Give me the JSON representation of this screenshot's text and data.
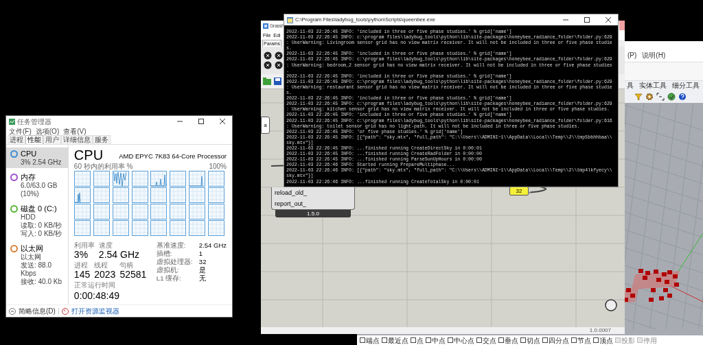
{
  "rhino": {
    "menus": [
      "(P)",
      "说明(H)"
    ],
    "ribbon_tabs": [
      "具",
      "实体工具",
      "细分工具"
    ],
    "osnaps": [
      {
        "label": "端点",
        "checked": false,
        "disabled": false
      },
      {
        "label": "最近点",
        "checked": false,
        "disabled": false
      },
      {
        "label": "点",
        "checked": false,
        "disabled": false
      },
      {
        "label": "中点",
        "checked": false,
        "disabled": false
      },
      {
        "label": "中心点",
        "checked": false,
        "disabled": false
      },
      {
        "label": "交点",
        "checked": false,
        "disabled": false
      },
      {
        "label": "垂点",
        "checked": false,
        "disabled": false
      },
      {
        "label": "切点",
        "checked": false,
        "disabled": false
      },
      {
        "label": "四分点",
        "checked": false,
        "disabled": false
      },
      {
        "label": "节点",
        "checked": false,
        "disabled": false
      },
      {
        "label": "顶点",
        "checked": false,
        "disabled": false
      },
      {
        "label": "投影",
        "checked": false,
        "disabled": true
      },
      {
        "label": "停用",
        "checked": false,
        "disabled": true
      }
    ]
  },
  "grasshopper": {
    "title": "Grassh",
    "menus": [
      "File",
      "Edi"
    ],
    "tab": "Params",
    "node_label": "a",
    "inputs": [
      "reload_old_",
      "report_out_"
    ],
    "version": "1.5.0",
    "panel_value": "32",
    "status": "1.0.0007"
  },
  "console": {
    "title": "C:\\Program Files\\ladybug_tools\\python\\Scripts\\queenbee.exe",
    "lines": [
      "2022-11-03 22:26:45 INFO: 'included in three or five phase studies.' % grid['name']",
      "2022-11-03 22:26:45 INFO: c:\\program files\\ladybug_tools\\python\\lib\\site-packages\\honeybee_radiance_folder\\folder.py:629",
      ": UserWarning: Livingroom sensor grid has no view matrix receiver. It will not be included in three or five phase studie",
      "s.",
      "2022-11-03 22:26:45 INFO: 'included in three or five phase studies.' % grid['name']",
      "2022-11-03 22:26:45 INFO: c:\\program files\\ladybug_tools\\python\\lib\\site-packages\\honeybee_radiance_folder\\folder.py:629",
      ": UserWarning: bedroom_2 sensor grid has no view matrix receiver. It will not be included in three or five phase studies",
      ".",
      "2022-11-03 22:26:45 INFO: 'included in three or five phase studies.' % grid['name']",
      "2022-11-03 22:26:45 INFO: c:\\program files\\ladybug_tools\\python\\lib\\site-packages\\honeybee_radiance_folder\\folder.py:629",
      ": UserWarning: restaurant sensor grid has no view matrix receiver. It will not be included in three or five phase studie",
      "s.",
      "2022-11-03 22:26:45 INFO: 'included in three or five phase studies.' % grid['name']",
      "2022-11-03 22:26:45 INFO: c:\\program files\\ladybug_tools\\python\\lib\\site-packages\\honeybee_radiance_folder\\folder.py:629",
      ": UserWarning: kitchen sensor grid has no view matrix receiver. It will not be included in three or five phase studies.",
      "2022-11-03 22:26:45 INFO: 'included in three or five phase studies.' % grid['name']",
      "2022-11-03 22:26:45 INFO: c:\\program files\\ladybug_tools\\python\\lib\\site-packages\\honeybee_radiance_folder\\folder.py:616",
      ": UserWarning: toilet sensor grid has no light-path. It will not be included in three or five phase studies.",
      "2022-11-03 22:26:45 INFO: 'or five phase studies.' % grid['name']",
      "2022-11-03 22:26:45 INFO: [{\"path\": \"sky.mtx\", \"full_path\": \"C:\\\\Users\\\\ADMINI~1\\\\AppData\\\\Local\\\\Temp\\\\2\\\\tmp5bbhhbaa\\\\",
      "sky.mtx\"}]",
      "2022-11-03 22:26:45 INFO: ...finished running CreateDirectSky in 0:00:01",
      "2022-11-03 22:26:45 INFO: ...finished running CreateRadFolder in 0:00:00",
      "2022-11-03 22:26:45 INFO: ...finished running ParseSunUpHours in 0:00:00",
      "2022-11-03 22:26:46 INFO: Started running PrepareMultiphase...",
      "2022-11-03 22:26:46 INFO: [{\"path\": \"sky.mtx\", \"full_path\": \"C:\\\\Users\\\\ADMINI~1\\\\AppData\\\\Local\\\\Temp\\\\2\\\\tmp4lkfyecy\\\\",
      "sky.mtx\"}]",
      "2022-11-03 22:26:46 INFO: ...finished running CreateTotalSky in 0:00:01"
    ]
  },
  "task_manager": {
    "title": "任务管理器",
    "menus": [
      "文件(F)",
      "选项(O)",
      "查看(V)"
    ],
    "tabs": [
      {
        "label": "进程",
        "selected": false
      },
      {
        "label": "性能",
        "selected": true
      },
      {
        "label": "用户",
        "selected": false
      },
      {
        "label": "详细信息",
        "selected": false
      },
      {
        "label": "服务",
        "selected": false
      }
    ],
    "resources": [
      {
        "name": "CPU",
        "lines": [
          "3% 2.54 GHz"
        ],
        "selected": true,
        "color": "#3b8ed8"
      },
      {
        "name": "内存",
        "lines": [
          "6.0/63.0 GB (10%)"
        ],
        "selected": false,
        "color": "#a04fcf"
      },
      {
        "name": "磁盘 0 (C:)",
        "lines": [
          "HDD",
          "读取: 0 KB/秒",
          "写入: 0 KB/秒"
        ],
        "selected": false,
        "color": "#5bb53a"
      },
      {
        "name": "以太网",
        "lines": [
          "以太网",
          "发送: 88.0 Kbps",
          "接收: 40.0 Kb"
        ],
        "selected": false,
        "color": "#d8843c"
      }
    ],
    "heading": "CPU",
    "processor": "AMD EPYC 7K83 64-Core Processor",
    "graph_label": "60 秒内的利用率 %",
    "graph_max": "100%",
    "stat_rows": [
      [
        {
          "label": "利用率",
          "value": "3%"
        },
        {
          "label": "速度",
          "value": "2.54 GHz"
        }
      ],
      [
        {
          "label": "进程",
          "value": "145"
        },
        {
          "label": "线程",
          "value": "2023"
        },
        {
          "label": "句柄",
          "value": "52581"
        }
      ]
    ],
    "uptime_label": "正常运行时间",
    "uptime": "0:00:48:49",
    "details": [
      {
        "label": "基准速度:",
        "value": "2.54 GHz"
      },
      {
        "label": "插槽:",
        "value": "1"
      },
      {
        "label": "虚拟处理器:",
        "value": "32"
      },
      {
        "label": "虚拟机:",
        "value": "是"
      },
      {
        "label": "L1 缓存:",
        "value": "无"
      }
    ],
    "fewer_details": "简略信息(D)",
    "open_monitor": "打开资源监视器"
  }
}
